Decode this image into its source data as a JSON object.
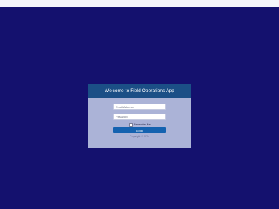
{
  "header": {
    "title": "Welcome to Field Operations App"
  },
  "form": {
    "email_placeholder": "Email Address",
    "password_placeholder": "Password",
    "remember_label": "Remember Me",
    "login_label": "Login"
  },
  "footer": {
    "copyright": "Copyright © 2024"
  },
  "colors": {
    "background": "#14116e",
    "header": "#1b4f86",
    "card": "#abb3d7",
    "button": "#1462b0"
  }
}
